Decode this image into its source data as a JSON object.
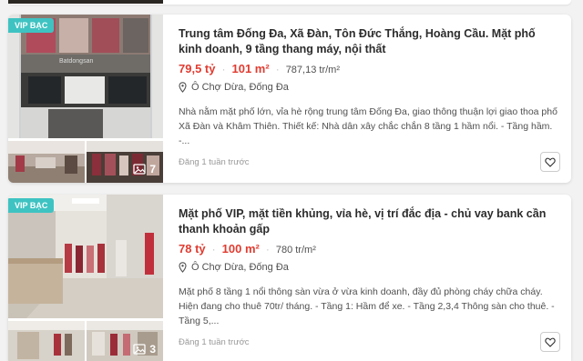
{
  "listings": [
    {
      "badge": "VIP BẠC",
      "title": "Trung tâm Đống Đa, Xã Đàn, Tôn Đức Thắng, Hoàng Cầu. Mặt phố kinh doanh, 9 tầng thang máy, nội thất",
      "price": "79,5 tỷ",
      "area": "101 m²",
      "price_per_m2": "787,13 tr/m²",
      "location": "Ô Chợ Dừa, Đống Đa",
      "description": "Nhà nằm mặt phố lớn, vỉa hè rộng trung tâm Đống Đa, giao thông thuận lợi giao thoa phố Xã Đàn và Khâm Thiên. Thiết kế: Nhà dân xây chắc chắn 8 tầng 1 hầm nổi. - Tầng hầm. -...",
      "posted": "Đăng 1 tuần trước",
      "photo_count": "7",
      "watermark": "Batdongsan"
    },
    {
      "badge": "VIP BẠC",
      "title": "Mặt phố VIP, mặt tiền khủng, vỉa hè, vị trí đắc địa - chủ vay bank cần thanh khoản gấp",
      "price": "78 tỷ",
      "area": "100 m²",
      "price_per_m2": "780 tr/m²",
      "location": "Ô Chợ Dừa, Đống Đa",
      "description": "Mặt phố 8 tầng 1 nổi thông sàn vừa ở vừa kinh doanh, đầy đủ phòng cháy chữa cháy. Hiện đang cho thuê 70tr/ tháng. - Tầng 1: Hầm để xe. - Tầng 2,3,4 Thông sàn cho thuê. - Tầng 5,...",
      "posted": "Đăng 1 tuần trước",
      "photo_count": "3"
    }
  ],
  "icons": {
    "photo": "image-icon",
    "location": "map-pin-icon",
    "save": "heart-icon"
  },
  "colors": {
    "price": "#e03c31",
    "badge": "#3ec3c2"
  }
}
